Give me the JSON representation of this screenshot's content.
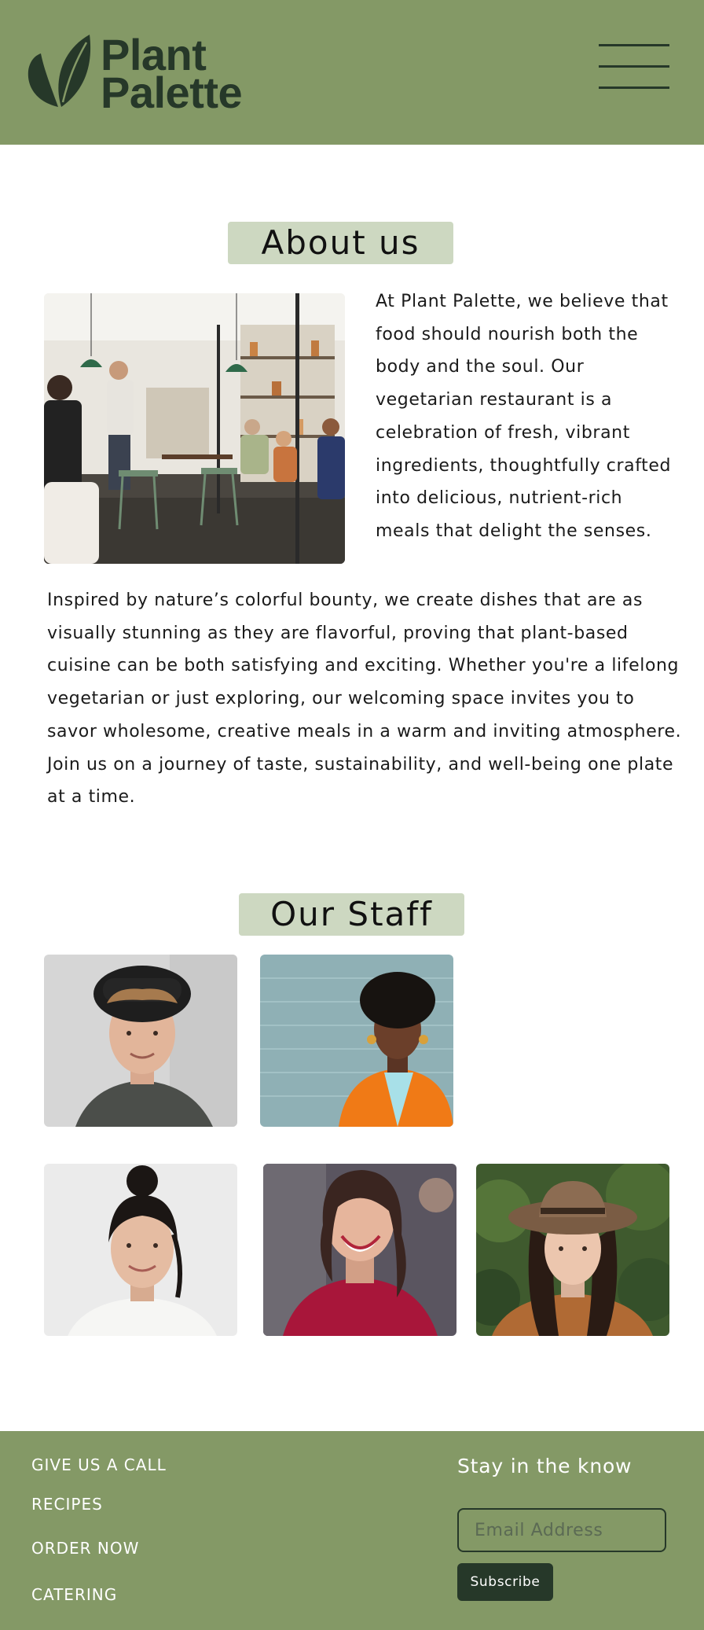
{
  "brand": {
    "name_line1": "Plant",
    "name_line2": "Palette",
    "header_bg": "#849966",
    "dark_green": "#263829",
    "title_bg": "#cdd8c1"
  },
  "header": {
    "logo_icon": "leaf-icon",
    "menu_icon": "hamburger-menu-icon"
  },
  "about": {
    "title": "About us",
    "photo": "restaurant-interior-photo",
    "intro": "At Plant Palette, we believe that food should nourish both the body and the soul. Our vegetarian restaurant is a celebration of fresh, vibrant ingredients, thoughtfully crafted into delicious, nutrient-rich meals that delight the senses.",
    "body": "Inspired by nature’s colorful bounty, we create dishes that are as visually stunning as they are flavorful, proving that plant-based cuisine can be both satisfying and exciting. Whether you're a lifelong vegetarian or just exploring, our welcoming space invites you to savor wholesome, creative meals in a warm and inviting atmosphere. Join us on a journey of taste, sustainability, and well-being one plate at a time."
  },
  "staff": {
    "title": "Our Staff",
    "members": [
      {
        "photo": "staff-photo-man-hat"
      },
      {
        "photo": "staff-photo-woman-orange-blazer"
      },
      {
        "photo": "staff-photo-woman-white-shirt"
      },
      {
        "photo": "staff-photo-woman-red-sweater"
      },
      {
        "photo": "staff-photo-woman-brown-hat"
      }
    ]
  },
  "footer": {
    "links": [
      "GIVE US A CALL",
      "RECIPES",
      "ORDER NOW",
      "CATERING"
    ],
    "newsletter_title": "Stay in the know",
    "email_placeholder": "Email Address",
    "subscribe_label": "Subscribe"
  }
}
